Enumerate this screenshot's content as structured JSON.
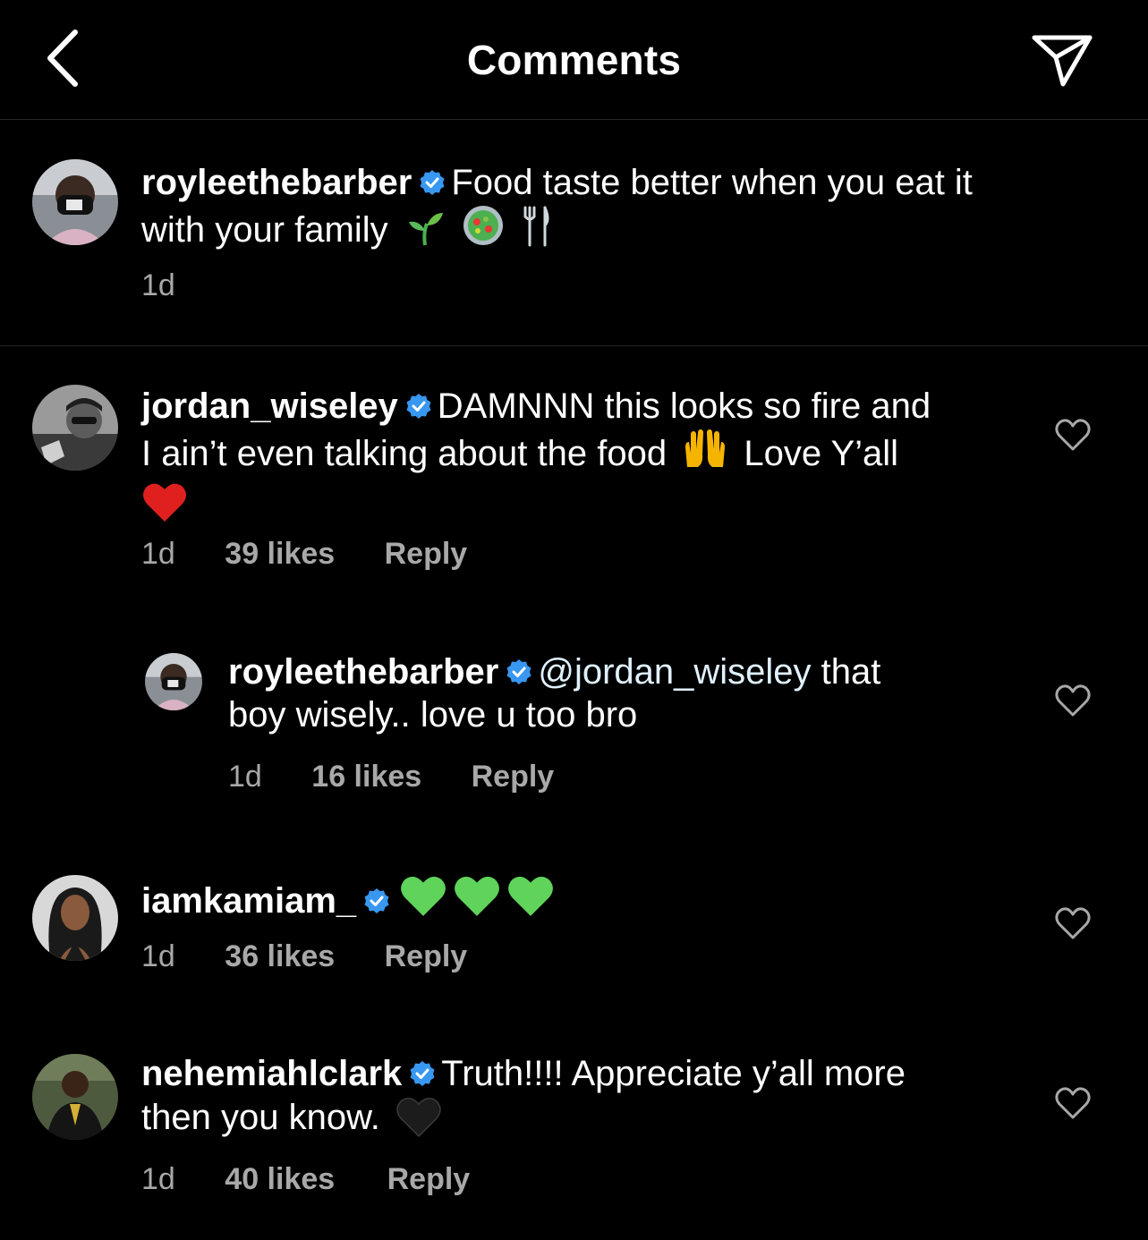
{
  "header": {
    "title": "Comments",
    "back_icon": "chevron-left-icon",
    "send_icon": "direct-send-icon"
  },
  "caption": {
    "username": "royleethebarber",
    "verified": true,
    "text_line1": "Food taste better when you eat it",
    "text_line2": "with your family",
    "emojis": [
      "seedling",
      "salad",
      "fork-and-knife"
    ],
    "time": "1d"
  },
  "comments": [
    {
      "username": "jordan_wiseley",
      "verified": true,
      "text_line1": "DAMNNN this looks so fire and",
      "text_line2a": "I ain’t even talking about the food",
      "text_line2b": "Love Y’all",
      "emojis": [
        "raising-hands",
        "red-heart"
      ],
      "time": "1d",
      "likes": "39 likes",
      "reply": "Reply"
    },
    {
      "username": "royleethebarber",
      "verified": true,
      "mention": "@jordan_wiseley",
      "text_line1": "that",
      "text_line2": "boy wisely.. love u too bro",
      "time": "1d",
      "likes": "16 likes",
      "reply": "Reply"
    },
    {
      "username": "iamkamiam_",
      "verified": true,
      "emojis": [
        "green-heart",
        "green-heart",
        "green-heart"
      ],
      "time": "1d",
      "likes": "36 likes",
      "reply": "Reply"
    },
    {
      "username": "nehemiahlclark",
      "verified": true,
      "text_line1": "Truth!!!! Appreciate y’all more",
      "text_line2": "then you know.",
      "emojis": [
        "black-heart"
      ],
      "time": "1d",
      "likes": "40 likes",
      "reply": "Reply"
    }
  ],
  "colors": {
    "background": "#000000",
    "text": "#ffffff",
    "secondary_text": "#a8a8a8",
    "verified_badge": "#3897f0",
    "mention": "#e0f1ff",
    "divider": "#262626"
  }
}
